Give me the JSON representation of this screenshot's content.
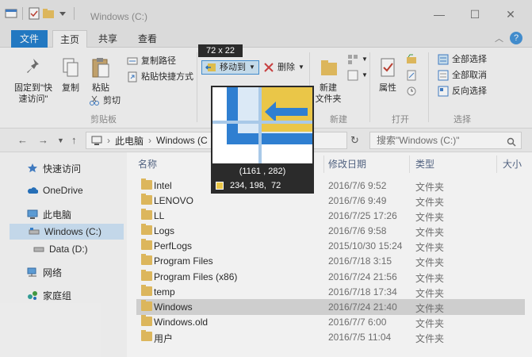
{
  "window": {
    "title": "Windows (C:)"
  },
  "tabs": {
    "file": "文件",
    "home": "主页",
    "share": "共享",
    "view": "查看"
  },
  "ribbon": {
    "pin_quick": "固定到\"快\n速访问\"",
    "copy": "复制",
    "paste": "粘贴",
    "copy_path": "复制路径",
    "paste_shortcut": "粘贴快捷方式",
    "cut": "剪切",
    "group_clipboard": "剪贴板",
    "move_to": "移动到",
    "delete": "删除",
    "new_folder": "新建\n文件夹",
    "group_new": "新建",
    "properties": "属性",
    "group_open": "打开",
    "select_all": "全部选择",
    "select_none": "全部取消",
    "invert_select": "反向选择",
    "group_select": "选择"
  },
  "address": {
    "crumbs": [
      "此电脑",
      "Windows (C"
    ],
    "search_placeholder": "搜索\"Windows (C:)\""
  },
  "nav": {
    "quick_access": "快速访问",
    "onedrive": "OneDrive",
    "this_pc": "此电脑",
    "windows_c": "Windows (C:)",
    "data_d": "Data (D:)",
    "network": "网络",
    "homegroup": "家庭组"
  },
  "columns": {
    "name": "名称",
    "date": "修改日期",
    "type": "类型",
    "size": "大小"
  },
  "files": [
    {
      "name": "Intel",
      "date": "2016/7/6 9:52",
      "type": "文件夹"
    },
    {
      "name": "LENOVO",
      "date": "2016/7/6 9:49",
      "type": "文件夹"
    },
    {
      "name": "LL",
      "date": "2016/7/25 17:26",
      "type": "文件夹"
    },
    {
      "name": "Logs",
      "date": "2016/7/6 9:58",
      "type": "文件夹"
    },
    {
      "name": "PerfLogs",
      "date": "2015/10/30 15:24",
      "type": "文件夹"
    },
    {
      "name": "Program Files",
      "date": "2016/7/18 3:15",
      "type": "文件夹"
    },
    {
      "name": "Program Files (x86)",
      "date": "2016/7/24 21:56",
      "type": "文件夹"
    },
    {
      "name": "temp",
      "date": "2016/7/18 17:34",
      "type": "文件夹"
    },
    {
      "name": "Windows",
      "date": "2016/7/24 21:40",
      "type": "文件夹"
    },
    {
      "name": "Windows.old",
      "date": "2016/7/7 6:00",
      "type": "文件夹"
    },
    {
      "name": "用户",
      "date": "2016/7/5 11:04",
      "type": "文件夹"
    }
  ],
  "overlay": {
    "size_tip": "72 x 22",
    "coords": "(1161 , 282)",
    "color_values": "234, 198,  72",
    "swatch_color": "#eac648"
  },
  "colors": {
    "accent": "#1979ca",
    "folder": "#e8be5a",
    "selection": "#cce3f7"
  }
}
